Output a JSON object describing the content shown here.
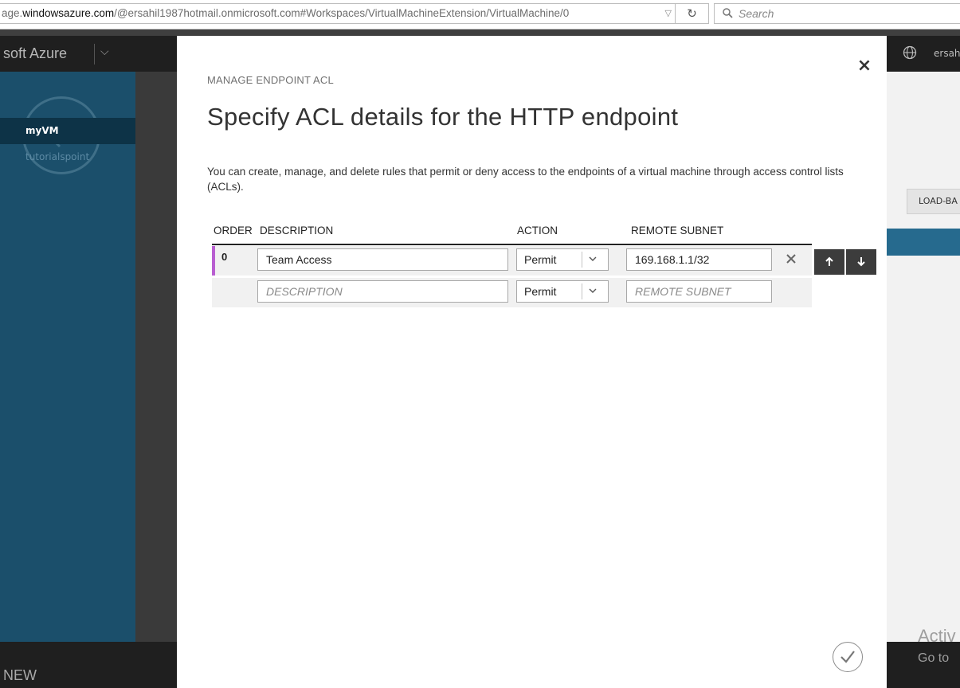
{
  "browser": {
    "url_prefix": "age.",
    "url_host": "windowsazure.com",
    "url_path": "/@ersahil1987hotmail.onmicrosoft.com#Workspaces/VirtualMachineExtension/VirtualMachine/0",
    "search_placeholder": "Search"
  },
  "portal": {
    "brand": "soft Azure",
    "user": "ersah",
    "back_icon": "back-arrow-icon",
    "left_nav": [
      {
        "label": "myVM",
        "active": true
      },
      {
        "label": "tutorialspoint",
        "active": false
      }
    ],
    "right_tab": "LOAD-BA",
    "new_label": "NEW",
    "activate_title": "Activ",
    "activate_sub": "Go to"
  },
  "dialog": {
    "eyebrow": "MANAGE ENDPOINT ACL",
    "title": "Specify ACL details for the HTTP endpoint",
    "description": "You can create, manage, and delete rules that permit or deny access to the endpoints of a virtual machine through access control lists (ACLs).",
    "columns": {
      "order": "ORDER",
      "description": "DESCRIPTION",
      "action": "ACTION",
      "remote_subnet": "REMOTE SUBNET"
    },
    "rules": [
      {
        "order": "0",
        "description": "Team Access",
        "action": "Permit",
        "remote_subnet": "169.168.1.1/32"
      }
    ],
    "new_rule": {
      "description_placeholder": "DESCRIPTION",
      "action": "Permit",
      "remote_subnet_placeholder": "REMOTE SUBNET"
    },
    "close_label": "×",
    "accent_color": "#b95fd1"
  }
}
